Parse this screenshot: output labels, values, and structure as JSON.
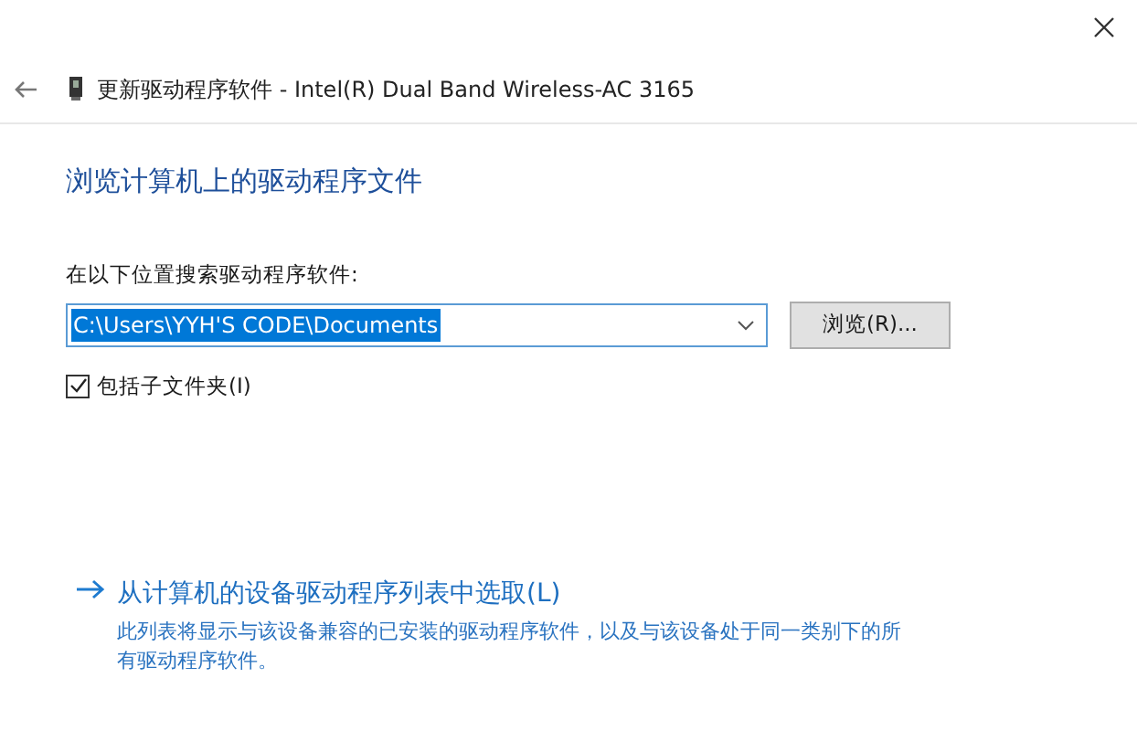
{
  "window": {
    "title": "更新驱动程序软件 - Intel(R) Dual Band Wireless-AC 3165"
  },
  "heading": "浏览计算机上的驱动程序文件",
  "search": {
    "label": "在以下位置搜索驱动程序软件:",
    "value": "C:\\Users\\YYH'S CODE\\Documents",
    "text_selected": true,
    "browse_button": "浏览(R)..."
  },
  "include_subfolders": {
    "label": "包括子文件夹(I)",
    "checked": true
  },
  "pick_link": {
    "label": "从计算机的设备驱动程序列表中选取(L)",
    "description": "此列表将显示与该设备兼容的已安装的驱动程序软件，以及与该设备处于同一类别下的所有驱动程序软件。"
  }
}
